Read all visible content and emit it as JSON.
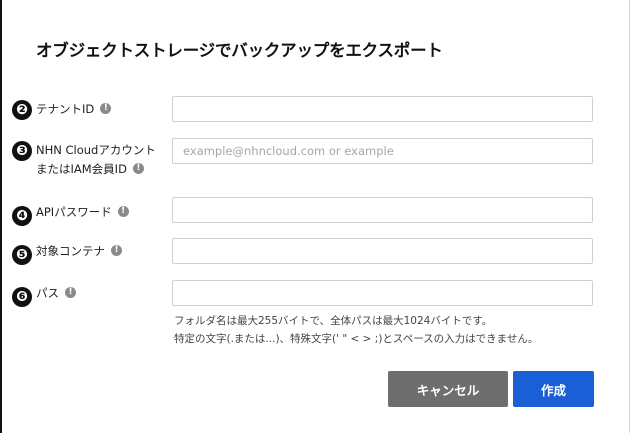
{
  "dialog": {
    "title": "オブジェクトストレージでバックアップをエクスポート"
  },
  "fields": [
    {
      "number": "❷",
      "label": "テナントID",
      "label_line2": "",
      "value": "",
      "placeholder": ""
    },
    {
      "number": "❸",
      "label": "NHN Cloudアカウント",
      "label_line2": "またはIAM会員ID",
      "value": "",
      "placeholder": "example@nhncloud.com or example"
    },
    {
      "number": "❹",
      "label": "APIパスワード",
      "label_line2": "",
      "value": "",
      "placeholder": ""
    },
    {
      "number": "❺",
      "label": "対象コンテナ",
      "label_line2": "",
      "value": "",
      "placeholder": ""
    },
    {
      "number": "❻",
      "label": "パス",
      "label_line2": "",
      "value": "",
      "placeholder": ""
    }
  ],
  "help": {
    "line1": "フォルダ名は最大255バイトで、全体パスは最大1024バイトです。",
    "line2": "特定の文字(.または...)、特殊文字(' \" < > ;)とスペースの入力はできません。"
  },
  "buttons": {
    "cancel": "キャンセル",
    "create": "作成"
  },
  "icons": {
    "info": "info-icon"
  },
  "colors": {
    "primary": "#1a5fd6",
    "cancel": "#6e6e6e",
    "info_icon": "#8a8a8a"
  }
}
